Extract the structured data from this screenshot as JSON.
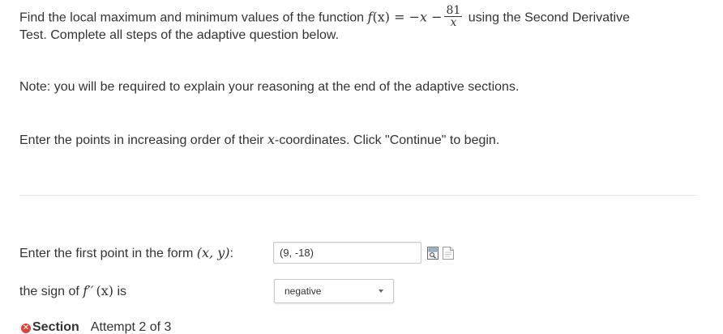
{
  "question": {
    "intro_part1": "Find the local maximum and minimum values of the function",
    "f_name": "f",
    "f_arg": "(x)",
    "equals": "=",
    "rhs_prefix": "−x −",
    "frac_num": "81",
    "frac_den": "x",
    "intro_part2": "using the Second Derivative",
    "intro_line2": "Test. Complete all steps of the adaptive question below.",
    "note": "Note: you will be required to explain your reasoning at the end of the adaptive sections.",
    "order_prefix": "Enter the points in increasing order of their",
    "order_var": "x",
    "order_suffix": "-coordinates. Click \"Continue\" to begin."
  },
  "first_point": {
    "label_prefix": "Enter the first point in the form",
    "label_math": "(x, y)",
    "label_suffix": ":",
    "value": "(9, -18)"
  },
  "sign_field": {
    "label_prefix": "the sign of",
    "label_math_f": "f′′",
    "label_math_arg": "(x)",
    "label_suffix": "is",
    "selected": "negative"
  },
  "section": {
    "title": "Section",
    "attempt": "Attempt 2 of 3",
    "status_color": "#d9443a"
  },
  "icons": {
    "preview": "preview-icon",
    "help": "help-document-icon",
    "status": "x-circle-icon",
    "dropdown": "chevron-down-icon"
  }
}
